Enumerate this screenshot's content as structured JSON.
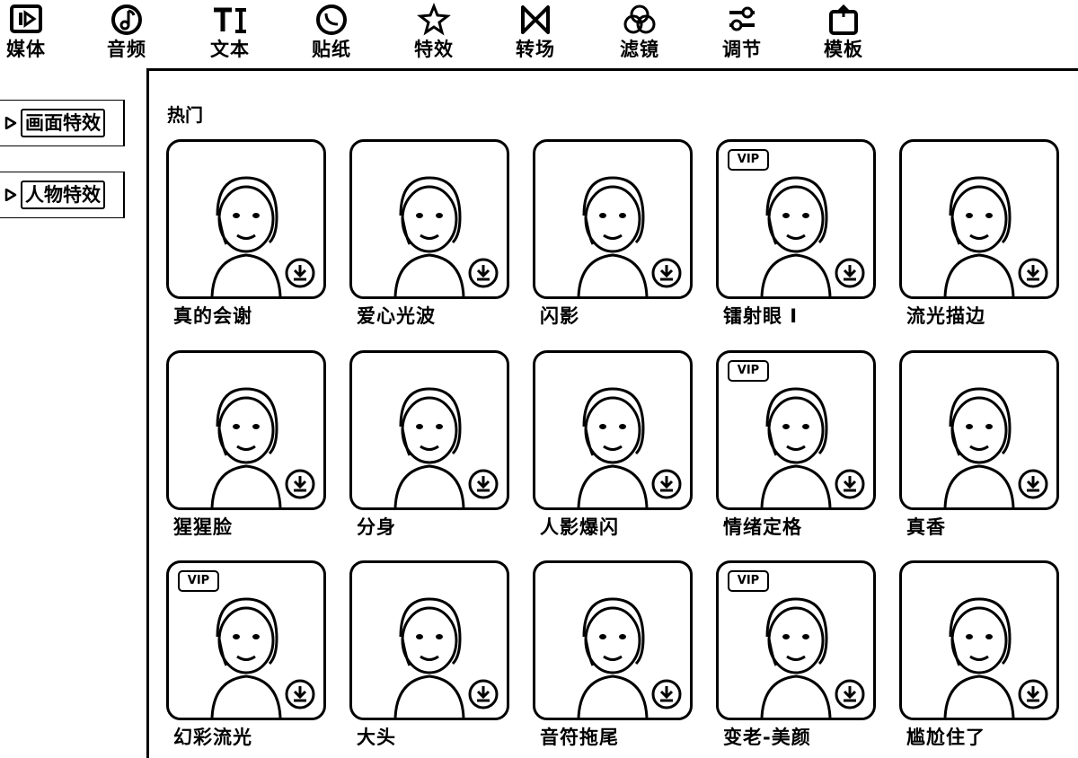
{
  "toolbar": {
    "tabs": [
      {
        "label": "媒体",
        "icon": "media-icon"
      },
      {
        "label": "音频",
        "icon": "audio-icon"
      },
      {
        "label": "文本",
        "icon": "text-icon"
      },
      {
        "label": "贴纸",
        "icon": "sticker-icon"
      },
      {
        "label": "特效",
        "icon": "effects-icon"
      },
      {
        "label": "转场",
        "icon": "transition-icon"
      },
      {
        "label": "滤镜",
        "icon": "filter-icon"
      },
      {
        "label": "调节",
        "icon": "adjust-icon"
      },
      {
        "label": "模板",
        "icon": "template-icon"
      }
    ]
  },
  "sidebar": {
    "items": [
      {
        "label": "画面特效"
      },
      {
        "label": "人物特效"
      }
    ]
  },
  "main": {
    "section_title": "热门",
    "vip_badge": "VIP",
    "effects": [
      {
        "label": "真的会谢",
        "vip": false
      },
      {
        "label": "爱心光波",
        "vip": false
      },
      {
        "label": "闪影",
        "vip": false
      },
      {
        "label": "镭射眼 I",
        "vip": true
      },
      {
        "label": "流光描边",
        "vip": false
      },
      {
        "label": "猩猩脸",
        "vip": false
      },
      {
        "label": "分身",
        "vip": false
      },
      {
        "label": "人影爆闪",
        "vip": false
      },
      {
        "label": "情绪定格",
        "vip": true
      },
      {
        "label": "真香",
        "vip": false
      },
      {
        "label": "幻彩流光",
        "vip": true
      },
      {
        "label": "大头",
        "vip": false
      },
      {
        "label": "音符拖尾",
        "vip": false
      },
      {
        "label": "变老-美颜",
        "vip": true
      },
      {
        "label": "尴尬住了",
        "vip": false
      }
    ]
  }
}
